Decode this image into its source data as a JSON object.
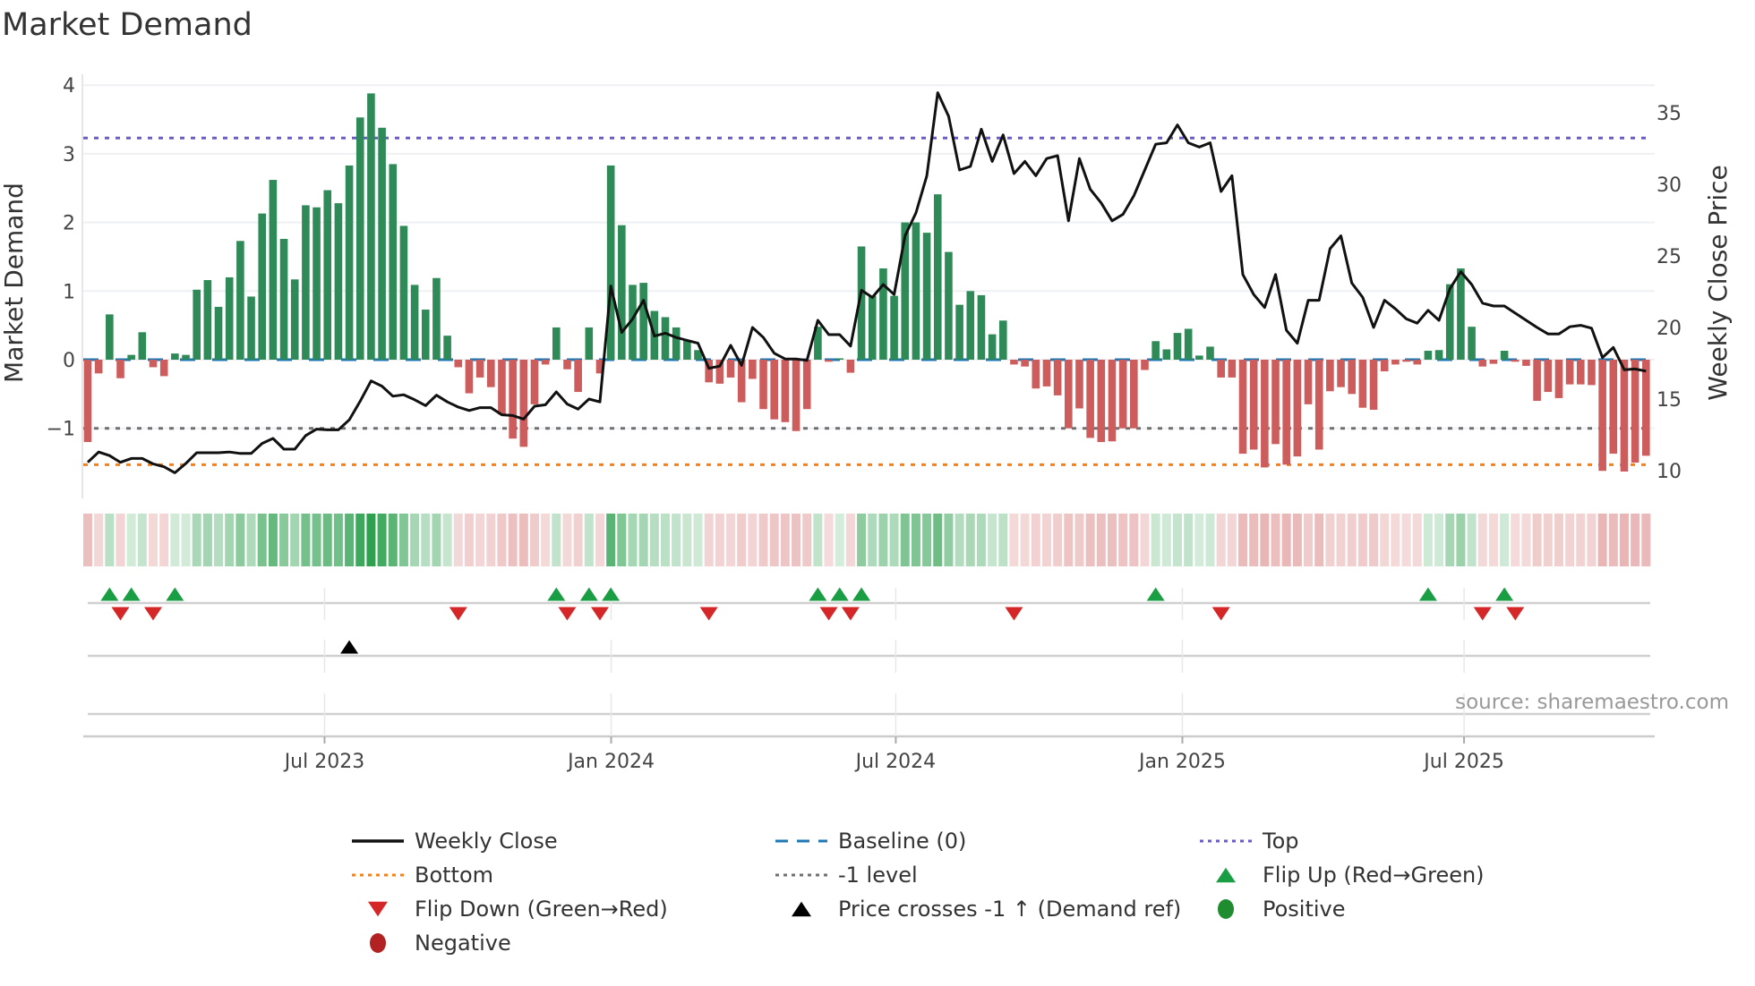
{
  "title": "Market Demand",
  "source": "source: sharemaestro.com",
  "colors": {
    "bar_positive": "#2e8b57",
    "bar_negative": "#cd5c5c",
    "price_line": "#111111",
    "baseline": "#1f77b4",
    "top": "#6a5acd",
    "minus_one": "#707070",
    "bottom": "#ff7f0e",
    "flip_up": "#1a9e44",
    "flip_down": "#d62728",
    "cross": "#000000",
    "positive_dot": "#1f8c2f",
    "negative_dot": "#b22222"
  },
  "legend": [
    {
      "label": "Weekly Close",
      "symbol": "line-solid",
      "color": "#111111"
    },
    {
      "label": "Baseline (0)",
      "symbol": "line-dashed",
      "color": "#1f77b4"
    },
    {
      "label": "Top",
      "symbol": "line-dotted",
      "color": "#6a5acd"
    },
    {
      "label": "Bottom",
      "symbol": "line-dotted",
      "color": "#ff7f0e"
    },
    {
      "label": "-1 level",
      "symbol": "line-dotted",
      "color": "#707070"
    },
    {
      "label": "Flip Up (Red→Green)",
      "symbol": "triangle-up",
      "color": "#1a9e44"
    },
    {
      "label": "Flip Down (Green→Red)",
      "symbol": "triangle-down",
      "color": "#d62728"
    },
    {
      "label": "Price crosses -1 ↑ (Demand ref)",
      "symbol": "triangle-up",
      "color": "#000000"
    },
    {
      "label": "Positive",
      "symbol": "circle",
      "color": "#1f8c2f"
    },
    {
      "label": "Negative",
      "symbol": "circle",
      "color": "#b22222"
    }
  ],
  "chart_data": {
    "type": "bar+line",
    "title": "Market Demand",
    "ylabel": "Market Demand",
    "y2label": "Weekly Close Price",
    "x_start": "2023-01-27",
    "x_frequency": "weekly",
    "xticks": [
      "Jul 2023",
      "Jan 2024",
      "Jul 2024",
      "Jan 2025",
      "Jul 2025"
    ],
    "xtick_week_index": [
      21.73,
      48.03,
      74.15,
      100.45,
      126.3
    ],
    "ylim": [
      -2.02,
      4.16
    ],
    "y2lim": [
      8.06,
      37.7
    ],
    "yticks": [
      {
        "v": 4,
        "label": "4"
      },
      {
        "v": 3,
        "label": "3"
      },
      {
        "v": 2,
        "label": "2"
      },
      {
        "v": 1,
        "label": "1"
      },
      {
        "v": 0,
        "label": "0"
      },
      {
        "v": -1,
        "label": "−1"
      }
    ],
    "y2ticks": [
      {
        "v": 35,
        "label": "35"
      },
      {
        "v": 30,
        "label": "30"
      },
      {
        "v": 25,
        "label": "25"
      },
      {
        "v": 20,
        "label": "20"
      },
      {
        "v": 15,
        "label": "15"
      },
      {
        "v": 10,
        "label": "10"
      }
    ],
    "levels": {
      "top": 3.23,
      "baseline": 0,
      "minus_one": -1,
      "bottom": -1.53
    },
    "demand": [
      -1.2,
      -0.2,
      0.66,
      -0.27,
      0.07,
      0.4,
      -0.11,
      -0.24,
      0.09,
      0.07,
      1.02,
      1.16,
      0.77,
      1.2,
      1.73,
      0.92,
      2.13,
      2.62,
      1.76,
      1.17,
      2.25,
      2.22,
      2.47,
      2.28,
      2.83,
      3.53,
      3.88,
      3.38,
      2.85,
      1.95,
      1.09,
      0.73,
      1.19,
      0.35,
      -0.11,
      -0.49,
      -0.26,
      -0.4,
      -0.8,
      -1.15,
      -1.27,
      -0.65,
      -0.07,
      0.47,
      -0.14,
      -0.47,
      0.47,
      -0.2,
      2.83,
      1.96,
      1.09,
      1.12,
      0.71,
      0.62,
      0.47,
      0.28,
      0.14,
      -0.33,
      -0.35,
      -0.26,
      -0.62,
      -0.28,
      -0.72,
      -0.87,
      -0.91,
      -1.04,
      -0.72,
      0.48,
      -0.03,
      0.02,
      -0.19,
      1.65,
      0.93,
      1.33,
      0.93,
      2.0,
      2.0,
      1.85,
      2.41,
      1.57,
      0.8,
      1.0,
      0.94,
      0.37,
      0.57,
      -0.07,
      -0.1,
      -0.42,
      -0.39,
      -0.52,
      -1.0,
      -0.71,
      -1.14,
      -1.2,
      -1.19,
      -1.0,
      -1.0,
      -0.15,
      0.27,
      0.15,
      0.39,
      0.45,
      0.06,
      0.19,
      -0.26,
      -0.26,
      -1.37,
      -1.31,
      -1.57,
      -1.23,
      -1.53,
      -1.41,
      -0.65,
      -1.31,
      -0.46,
      -0.4,
      -0.5,
      -0.7,
      -0.73,
      -0.17,
      -0.07,
      -0.03,
      -0.07,
      0.13,
      0.14,
      1.1,
      1.33,
      0.48,
      -0.1,
      -0.06,
      0.13,
      -0.03,
      -0.09,
      -0.6,
      -0.47,
      -0.56,
      -0.36,
      -0.36,
      -0.37,
      -1.62,
      -1.37,
      -1.63,
      -1.5,
      -1.4
    ],
    "weekly_close": [
      10.58,
      11.3,
      11.05,
      10.58,
      10.85,
      10.85,
      10.47,
      10.27,
      9.85,
      10.5,
      11.25,
      11.25,
      11.25,
      11.3,
      11.2,
      11.2,
      11.9,
      12.25,
      11.5,
      11.5,
      12.45,
      12.9,
      12.85,
      12.85,
      13.55,
      14.85,
      16.27,
      15.9,
      15.2,
      15.3,
      14.95,
      14.54,
      15.27,
      14.8,
      14.44,
      14.2,
      14.4,
      14.4,
      13.9,
      13.85,
      13.6,
      14.5,
      14.6,
      15.5,
      14.65,
      14.3,
      15.0,
      14.8,
      22.9,
      19.65,
      20.6,
      21.9,
      19.4,
      19.6,
      19.3,
      19.1,
      18.9,
      17.15,
      17.3,
      18.75,
      17.35,
      20.0,
      19.3,
      18.2,
      17.8,
      17.8,
      17.7,
      20.5,
      19.5,
      19.5,
      18.7,
      22.6,
      22.1,
      23.0,
      22.3,
      26.4,
      28.0,
      30.6,
      36.4,
      34.75,
      31.0,
      31.25,
      33.85,
      31.6,
      33.45,
      30.75,
      31.6,
      30.6,
      31.8,
      32.0,
      27.45,
      31.8,
      29.65,
      28.7,
      27.45,
      27.9,
      29.2,
      31.0,
      32.8,
      32.9,
      34.15,
      32.9,
      32.6,
      32.9,
      29.5,
      30.6,
      23.7,
      22.3,
      21.4,
      23.7,
      19.8,
      18.9,
      21.9,
      21.9,
      25.5,
      26.4,
      23.1,
      22.1,
      20.0,
      21.9,
      21.3,
      20.6,
      20.3,
      21.2,
      20.5,
      22.7,
      23.9,
      23.0,
      21.7,
      21.5,
      21.5,
      21.0,
      20.5,
      20.0,
      19.55,
      19.55,
      20.05,
      20.15,
      19.95,
      17.9,
      18.6,
      17.05,
      17.1,
      16.95
    ],
    "price_cross_minus1_up_week_index": [
      24
    ],
    "legend_position": "bottom"
  }
}
